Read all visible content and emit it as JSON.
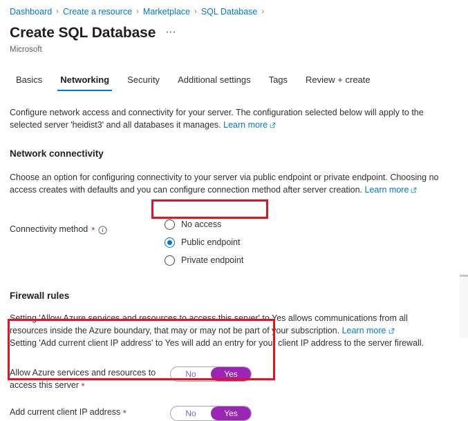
{
  "breadcrumb": {
    "items": [
      {
        "label": "Dashboard"
      },
      {
        "label": "Create a resource"
      },
      {
        "label": "Marketplace"
      },
      {
        "label": "SQL Database"
      }
    ],
    "separator": "›"
  },
  "header": {
    "title": "Create SQL Database",
    "ellipsis": "⋯",
    "subtitle": "Microsoft"
  },
  "tabs": [
    {
      "label": "Basics",
      "active": false
    },
    {
      "label": "Networking",
      "active": true
    },
    {
      "label": "Security",
      "active": false
    },
    {
      "label": "Additional settings",
      "active": false
    },
    {
      "label": "Tags",
      "active": false
    },
    {
      "label": "Review + create",
      "active": false
    }
  ],
  "intro": {
    "text": "Configure network access and connectivity for your server. The configuration selected below will apply to the selected server 'heidist3' and all databases it manages. ",
    "link": "Learn more"
  },
  "network_connectivity": {
    "heading": "Network connectivity",
    "description": "Choose an option for configuring connectivity to your server via public endpoint or private endpoint. Choosing no access creates with defaults and you can configure connection method after server creation. ",
    "link": "Learn more",
    "field": {
      "label": "Connectivity method",
      "required_marker": "*",
      "info_icon": "info-icon",
      "options": [
        {
          "label": "No access",
          "selected": false
        },
        {
          "label": "Public endpoint",
          "selected": true
        },
        {
          "label": "Private endpoint",
          "selected": false
        }
      ]
    }
  },
  "firewall_rules": {
    "heading": "Firewall rules",
    "description_line1": "Setting 'Allow Azure services and resources to access this server' to Yes allows communications from all resources inside the Azure boundary, that may or may not be part of your subscription. ",
    "link": "Learn more",
    "description_line2": "Setting 'Add current client IP address' to Yes will add an entry for your client IP address to the server firewall.",
    "toggles": [
      {
        "label": "Allow Azure services and resources to access this server",
        "required_marker": "*",
        "off_label": "No",
        "on_label": "Yes",
        "value": "Yes"
      },
      {
        "label": "Add current client IP address",
        "required_marker": "*",
        "off_label": "No",
        "on_label": "Yes",
        "value": "Yes"
      }
    ]
  },
  "annotations": [
    {
      "name": "connectivity-method-highlight",
      "color": "#e81123"
    },
    {
      "name": "firewall-rules-highlight",
      "color": "#e81123"
    }
  ],
  "colors": {
    "accent_blue": "#0078d4",
    "toggle_purple": "#9b26b6",
    "annotation_red": "#e81123",
    "required_red": "#a4262c"
  }
}
